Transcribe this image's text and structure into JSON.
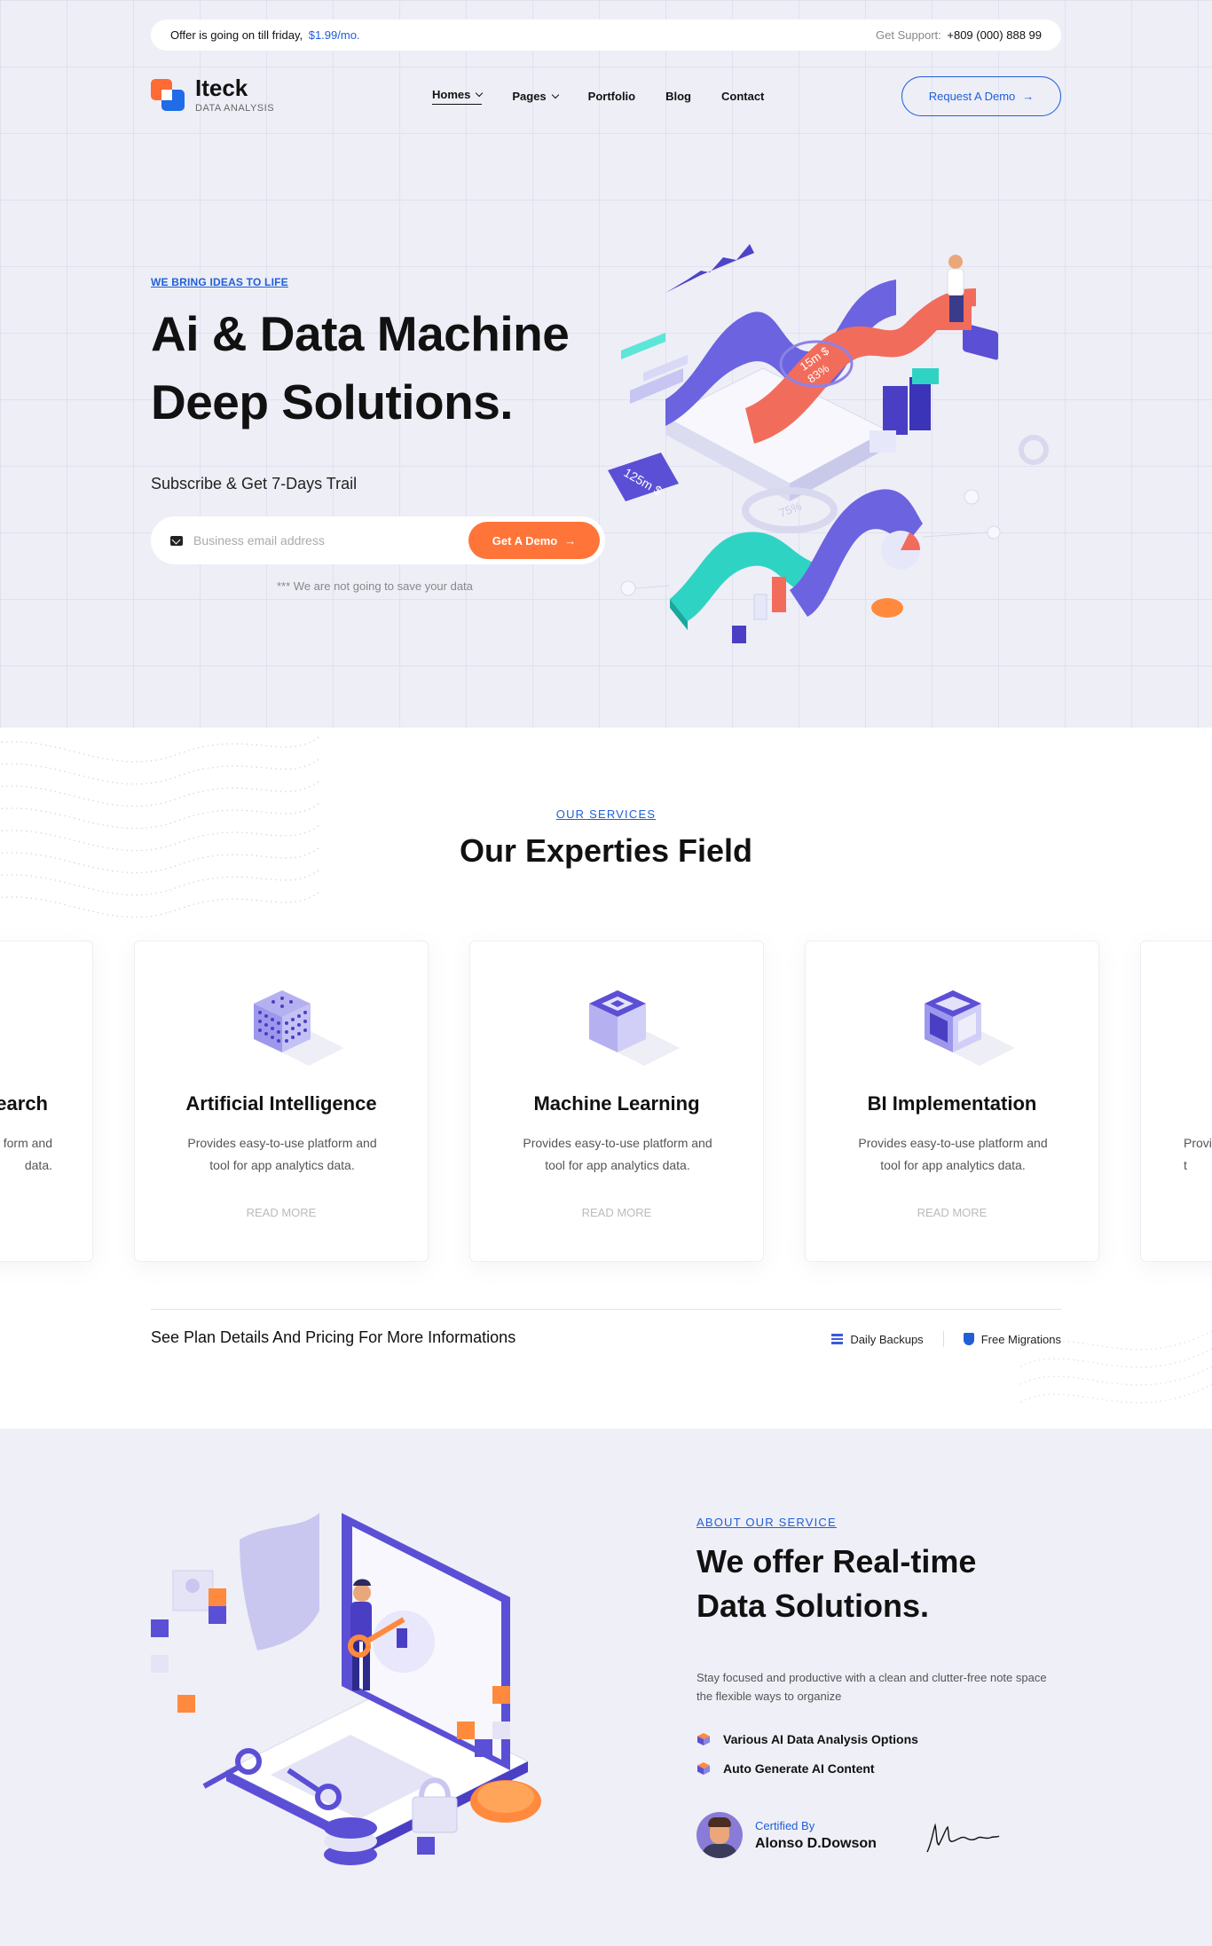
{
  "topbar": {
    "offer_text": "Offer is going on till friday,",
    "offer_price": "$1.99/mo.",
    "support_label": "Get Support:",
    "support_phone": "+809 (000) 888 99"
  },
  "brand": {
    "name": "Iteck",
    "tagline": "DATA ANALYSIS"
  },
  "nav": {
    "items": [
      {
        "label": "Homes",
        "dropdown": true,
        "active": true
      },
      {
        "label": "Pages",
        "dropdown": true
      },
      {
        "label": "Portfolio"
      },
      {
        "label": "Blog"
      },
      {
        "label": "Contact"
      }
    ],
    "cta": "Request A Demo"
  },
  "hero": {
    "eyebrow": "WE BRING IDEAS TO LIFE",
    "title_line1": "Ai & Data Machine",
    "title_line2": "Deep Solutions.",
    "subtitle": "Subscribe & Get 7-Days Trail",
    "email_placeholder": "Business email address",
    "cta": "Get A Demo",
    "note": "*** We are not going to save your data",
    "art_labels": {
      "a": "15m $",
      "b": "83%",
      "c": "125m $",
      "d": "75%"
    }
  },
  "services": {
    "eyebrow": "OUR SERVICES",
    "title": "Our Experties Field",
    "cards": [
      {
        "title": "earch",
        "desc_line1": "form and",
        "desc_line2": "data.",
        "read_more": ""
      },
      {
        "title": "Artificial Intelligence",
        "desc_line1": "Provides easy-to-use platform and",
        "desc_line2": "tool for app analytics data.",
        "read_more": "READ MORE",
        "icon": "grid-cube-icon"
      },
      {
        "title": "Machine Learning",
        "desc_line1": "Provides easy-to-use platform and",
        "desc_line2": "tool for app analytics data.",
        "read_more": "READ MORE",
        "icon": "solid-cube-icon"
      },
      {
        "title": "BI Implementation",
        "desc_line1": "Provides easy-to-use platform and",
        "desc_line2": "tool for app analytics data.",
        "read_more": "READ MORE",
        "icon": "frame-cube-icon"
      },
      {
        "title": "",
        "desc_line1": "Provi",
        "desc_line2": "t",
        "read_more": ""
      }
    ],
    "plan_text": "See Plan Details And Pricing For More Informations",
    "features": [
      {
        "label": "Daily Backups",
        "icon": "database-icon"
      },
      {
        "label": "Free Migrations",
        "icon": "shield-icon"
      }
    ]
  },
  "about": {
    "eyebrow": "ABOUT OUR SERVICE",
    "title_line1": "We offer Real-time",
    "title_line2": "Data Solutions.",
    "desc": "Stay focused and productive with a clean and clutter-free note space the flexible ways to organize",
    "list": [
      "Various AI Data Analysis Options",
      "Auto Generate AI Content"
    ],
    "cert_label": "Certified By",
    "cert_name": "Alonso D.Dowson"
  },
  "colors": {
    "accent": "#1f5fd8",
    "orange": "#ff7438",
    "purple": "#6c63d8",
    "teal": "#2fd3c4"
  }
}
